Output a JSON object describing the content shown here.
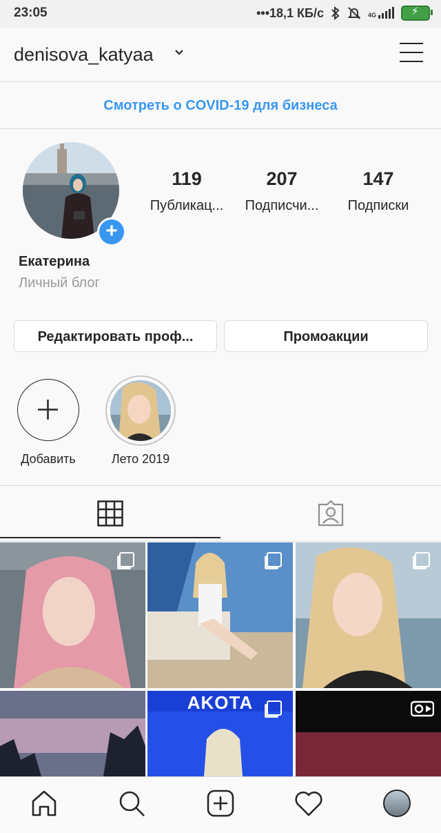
{
  "status_bar": {
    "time": "23:05",
    "network_speed": "•••18,1 КБ/с",
    "network_type": "4G",
    "icons": [
      "bluetooth-icon",
      "mute-icon",
      "signal-icon",
      "battery-charging-icon"
    ]
  },
  "header": {
    "username": "denisova_katyaa",
    "icons": [
      "chevron-down-icon",
      "menu-icon"
    ]
  },
  "covid_banner": {
    "text": "Смотреть о COVID-19 для бизнеса",
    "color": "#3897f0"
  },
  "profile": {
    "stats": [
      {
        "value": "119",
        "label": "Публикац..."
      },
      {
        "value": "207",
        "label": "Подписчи..."
      },
      {
        "value": "147",
        "label": "Подписки"
      }
    ],
    "display_name": "Екатерина",
    "category": "Личный блог"
  },
  "buttons": {
    "edit_profile": "Редактировать проф...",
    "promotions": "Промоакции"
  },
  "highlights": [
    {
      "label": "Добавить",
      "icon": "plus-icon"
    },
    {
      "label": "Лето 2019"
    }
  ],
  "tabs": [
    {
      "icon": "grid-icon",
      "active": true
    },
    {
      "icon": "tagged-person-icon",
      "active": false
    }
  ],
  "grid": {
    "posts": [
      {
        "type": "multi",
        "overlay_text": ""
      },
      {
        "type": "multi",
        "overlay_text": ""
      },
      {
        "type": "multi",
        "overlay_text": ""
      },
      {
        "type": "photo",
        "overlay_text": ""
      },
      {
        "type": "multi",
        "overlay_text": "AKOTA"
      },
      {
        "type": "video",
        "overlay_text": ""
      }
    ]
  },
  "bottom_nav": {
    "icons": [
      "home-icon",
      "search-icon",
      "new-post-icon",
      "activity-heart-icon",
      "profile-avatar"
    ]
  },
  "colors": {
    "accent": "#3897f0",
    "text": "#262626",
    "muted": "#999999",
    "border": "#dbdbdb",
    "battery": "#43a047"
  }
}
